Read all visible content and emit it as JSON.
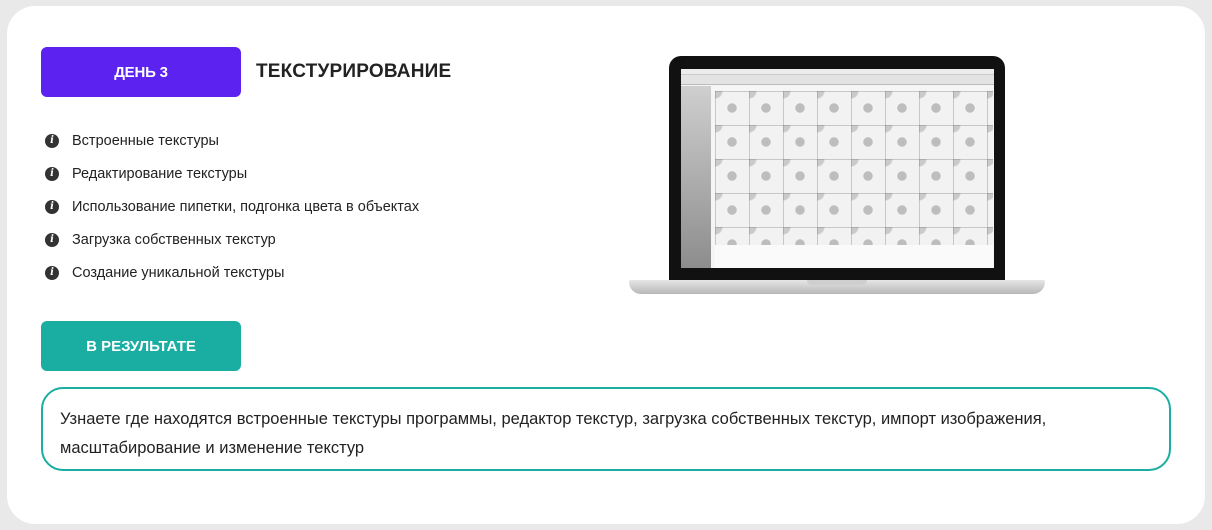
{
  "day": {
    "label": "ДЕНЬ 3"
  },
  "topic": {
    "title": "ТЕКСТУРИРОВАНИЕ"
  },
  "features": [
    {
      "label": "Встроенные текстуры",
      "icon": "info-icon"
    },
    {
      "label": "Редактирование текстуры",
      "icon": "info-icon"
    },
    {
      "label": "Использование пипетки, подгонка цвета в объектах",
      "icon": "info-icon"
    },
    {
      "label": "Загрузка собственных текстур",
      "icon": "info-icon"
    },
    {
      "label": "Создание уникальной текстуры",
      "icon": "info-icon"
    }
  ],
  "result": {
    "label": "В РЕЗУЛЬТАТЕ",
    "text": "Узнаете где находятся встроенные текстуры программы, редактор текстур, загрузка собственных текстур, импорт изображения, масштабирование и изменение текстур"
  },
  "colors": {
    "day_badge": "#5b22f0",
    "result_accent": "#1aada2"
  }
}
